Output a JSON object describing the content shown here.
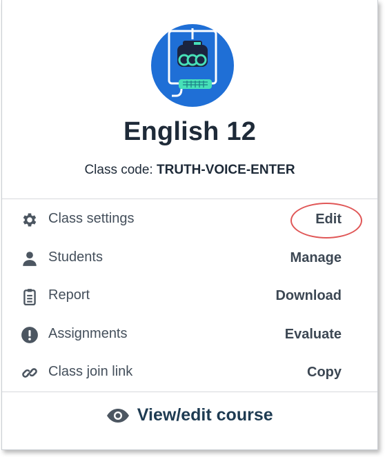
{
  "course": {
    "title": "English 12",
    "class_code_label": "Class code:",
    "class_code": "TRUTH-VOICE-ENTER",
    "avatar_icon": "robot-computer-icon",
    "avatar_color": "#1f6fd6"
  },
  "menu": [
    {
      "icon": "gear-icon",
      "label": "Class settings",
      "action": "Edit"
    },
    {
      "icon": "person-icon",
      "label": "Students",
      "action": "Manage"
    },
    {
      "icon": "clipboard-icon",
      "label": "Report",
      "action": "Download"
    },
    {
      "icon": "exclamation-circle-icon",
      "label": "Assignments",
      "action": "Evaluate"
    },
    {
      "icon": "link-icon",
      "label": "Class join link",
      "action": "Copy"
    }
  ],
  "footer": {
    "icon": "eye-icon",
    "label": "View/edit course"
  },
  "highlight": {
    "target": "Edit",
    "color": "#e05757"
  }
}
